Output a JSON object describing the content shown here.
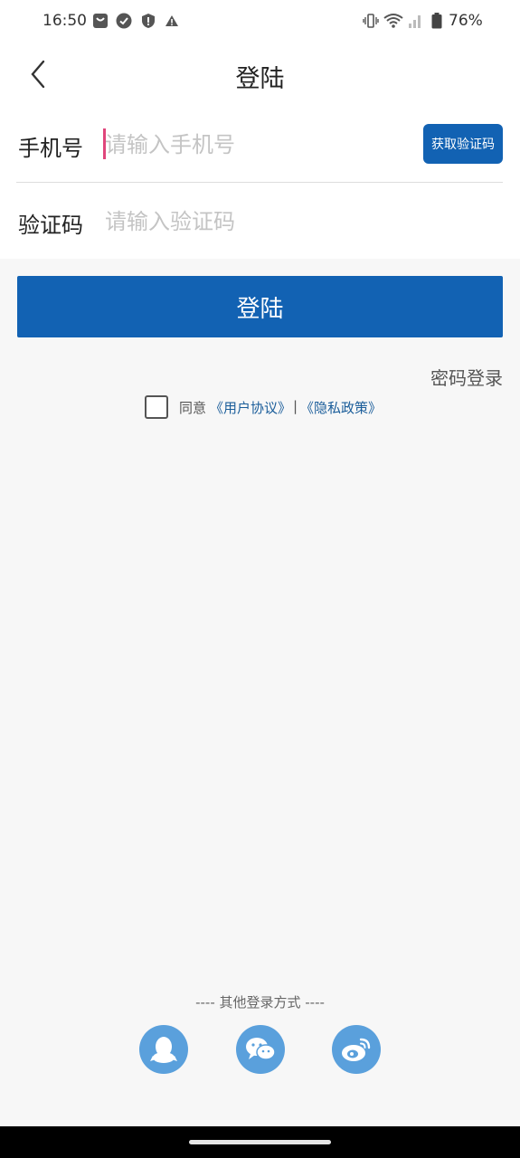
{
  "status_bar": {
    "time": "16:50",
    "battery": "76%",
    "icons": [
      "shopping-bag-icon",
      "check-circle-icon",
      "shield-alert-icon",
      "warning-icon",
      "vibrate-icon",
      "wifi-icon",
      "signal-icon",
      "battery-icon"
    ]
  },
  "header": {
    "back_icon": "chevron-left-icon",
    "title": "登陆"
  },
  "form": {
    "phone_label": "手机号",
    "phone_placeholder": "请输入手机号",
    "phone_value": "",
    "get_code_label": "获取验证码",
    "code_label": "验证码",
    "code_placeholder": "请输入验证码",
    "code_value": ""
  },
  "actions": {
    "login_label": "登陆",
    "password_login_label": "密码登录"
  },
  "agreement": {
    "checked": false,
    "prefix": "同意",
    "user_agreement": "《用户协议》",
    "separator": "|",
    "privacy_policy": "《隐私政策》"
  },
  "other_login": {
    "title": "---- 其他登录方式 ----",
    "options": [
      "qq-icon",
      "wechat-icon",
      "weibo-icon"
    ]
  },
  "colors": {
    "primary": "#1262b3",
    "link": "#1a5d9a",
    "social": "#5aa0dc",
    "caret": "#e0467c"
  }
}
